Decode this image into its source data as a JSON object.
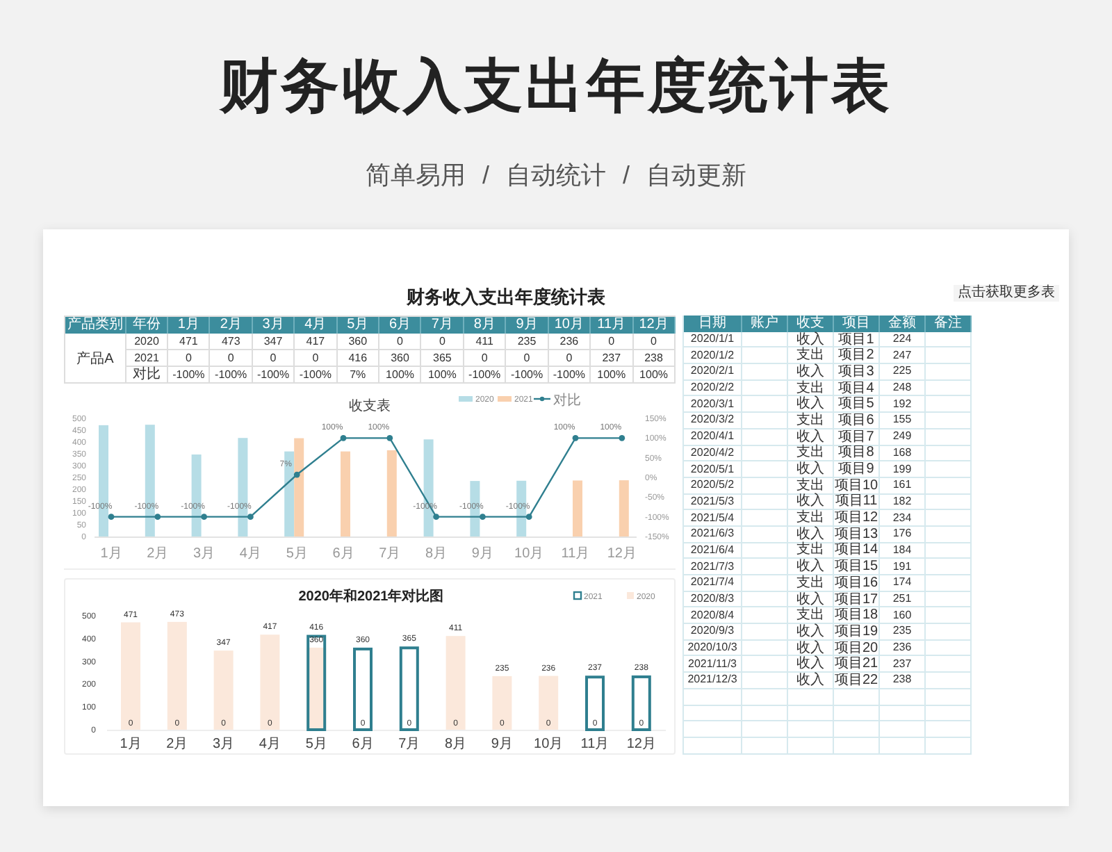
{
  "header": {
    "title": "财务收入支出年度统计表",
    "subtitle": [
      "简单易用",
      "/",
      "自动统计",
      "/",
      "自动更新"
    ]
  },
  "sheet": {
    "title": "财务收入支出年度统计表",
    "more_button": "点击获取更多表",
    "summary": {
      "columns": [
        "产品类别",
        "年份",
        "1月",
        "2月",
        "3月",
        "4月",
        "5月",
        "6月",
        "7月",
        "8月",
        "9月",
        "10月",
        "11月",
        "12月"
      ],
      "rows": [
        {
          "cells": [
            "",
            "2020",
            "471",
            "473",
            "347",
            "417",
            "360",
            "0",
            "0",
            "411",
            "235",
            "236",
            "0",
            "0"
          ]
        },
        {
          "cells": [
            "产品A",
            "2021",
            "0",
            "0",
            "0",
            "0",
            "416",
            "360",
            "365",
            "0",
            "0",
            "0",
            "237",
            "238"
          ]
        },
        {
          "cells": [
            "",
            "对比",
            "-100%",
            "-100%",
            "-100%",
            "-100%",
            "7%",
            "100%",
            "100%",
            "-100%",
            "-100%",
            "-100%",
            "100%",
            "100%"
          ]
        }
      ]
    },
    "charts": [
      {
        "chart_data": {
          "type": "bar",
          "title": "收支表",
          "legend": "top-right",
          "categories": [
            "1月",
            "2月",
            "3月",
            "4月",
            "5月",
            "6月",
            "7月",
            "8月",
            "9月",
            "10月",
            "11月",
            "12月"
          ],
          "series": [
            {
              "name": "2020",
              "color": "#b6dde6",
              "values": [
                471,
                473,
                347,
                417,
                360,
                0,
                0,
                411,
                235,
                236,
                0,
                0
              ]
            },
            {
              "name": "2021",
              "color": "#f9d0ae",
              "values": [
                0,
                0,
                0,
                0,
                416,
                360,
                365,
                0,
                0,
                0,
                237,
                238
              ]
            }
          ],
          "ylim": [
            0,
            500
          ],
          "yticks": [
            500,
            450,
            400,
            350,
            300,
            250,
            200,
            150,
            100,
            50,
            0
          ]
        }
      },
      {
        "chart_data": {
          "type": "line",
          "legend": "top-right",
          "series": [
            {
              "name": "对比",
              "color": "#2f7f8f",
              "marker": "circle",
              "values": [
                -100,
                -100,
                -100,
                -100,
                7,
                100,
                100,
                -100,
                -100,
                -100,
                100,
                100
              ]
            }
          ],
          "value_labels": [
            "-100%",
            "-100%",
            "-100%",
            "-100%",
            "7%",
            "100%",
            "100%",
            "-100%",
            "-100%",
            "-100%",
            "100%",
            "100%"
          ],
          "ylim": [
            -150,
            150
          ],
          "yticks": [
            {
              "value": 150,
              "label": "150%"
            },
            {
              "value": 100,
              "label": "100%"
            },
            {
              "value": 50,
              "label": "50%"
            },
            {
              "value": 0,
              "label": "0%"
            },
            {
              "value": -50,
              "label": "-50%"
            },
            {
              "value": -100,
              "label": "-100%"
            },
            {
              "value": -150,
              "label": "-150%"
            }
          ]
        }
      },
      {
        "chart_data": {
          "type": "bar",
          "title": "2020年和2021年对比图",
          "legend": "top-right",
          "categories": [
            "1月",
            "2月",
            "3月",
            "4月",
            "5月",
            "6月",
            "7月",
            "8月",
            "9月",
            "10月",
            "11月",
            "12月"
          ],
          "series": [
            {
              "name": "2021",
              "color": "#2f7f8f",
              "values": [
                0,
                0,
                0,
                0,
                416,
                360,
                365,
                0,
                0,
                0,
                237,
                238
              ]
            },
            {
              "name": "2020",
              "color": "#fbe8db",
              "values": [
                471,
                473,
                347,
                417,
                360,
                0,
                0,
                411,
                235,
                236,
                0,
                0
              ]
            }
          ],
          "ylim": [
            0,
            500
          ],
          "yticks": [
            500,
            400,
            300,
            200,
            100,
            0
          ],
          "data_labels": true
        }
      }
    ],
    "ledger": {
      "columns": [
        "日期",
        "账户",
        "收支",
        "项目",
        "金额",
        "备注"
      ],
      "rows": [
        {
          "date": "2020/1/1",
          "type": "收入",
          "item": "项目1",
          "amount": "224"
        },
        {
          "date": "2020/1/2",
          "type": "支出",
          "item": "项目2",
          "amount": "247"
        },
        {
          "date": "2020/2/1",
          "type": "收入",
          "item": "项目3",
          "amount": "225"
        },
        {
          "date": "2020/2/2",
          "type": "支出",
          "item": "项目4",
          "amount": "248"
        },
        {
          "date": "2020/3/1",
          "type": "收入",
          "item": "项目5",
          "amount": "192"
        },
        {
          "date": "2020/3/2",
          "type": "支出",
          "item": "项目6",
          "amount": "155"
        },
        {
          "date": "2020/4/1",
          "type": "收入",
          "item": "项目7",
          "amount": "249"
        },
        {
          "date": "2020/4/2",
          "type": "支出",
          "item": "项目8",
          "amount": "168"
        },
        {
          "date": "2020/5/1",
          "type": "收入",
          "item": "项目9",
          "amount": "199"
        },
        {
          "date": "2020/5/2",
          "type": "支出",
          "item": "项目10",
          "amount": "161"
        },
        {
          "date": "2021/5/3",
          "type": "收入",
          "item": "项目11",
          "amount": "182"
        },
        {
          "date": "2021/5/4",
          "type": "支出",
          "item": "项目12",
          "amount": "234"
        },
        {
          "date": "2021/6/3",
          "type": "收入",
          "item": "项目13",
          "amount": "176"
        },
        {
          "date": "2021/6/4",
          "type": "支出",
          "item": "项目14",
          "amount": "184"
        },
        {
          "date": "2021/7/3",
          "type": "收入",
          "item": "项目15",
          "amount": "191"
        },
        {
          "date": "2021/7/4",
          "type": "支出",
          "item": "项目16",
          "amount": "174"
        },
        {
          "date": "2020/8/3",
          "type": "收入",
          "item": "项目17",
          "amount": "251"
        },
        {
          "date": "2020/8/4",
          "type": "支出",
          "item": "项目18",
          "amount": "160"
        },
        {
          "date": "2020/9/3",
          "type": "收入",
          "item": "项目19",
          "amount": "235"
        },
        {
          "date": "2020/10/3",
          "type": "收入",
          "item": "项目20",
          "amount": "236"
        },
        {
          "date": "2021/11/3",
          "type": "收入",
          "item": "项目21",
          "amount": "237"
        },
        {
          "date": "2021/12/3",
          "type": "收入",
          "item": "项目22",
          "amount": "238"
        }
      ]
    }
  }
}
